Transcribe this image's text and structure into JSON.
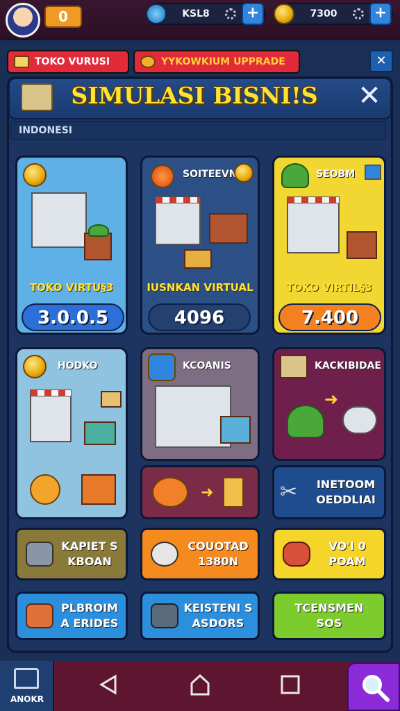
{
  "top_bar": {
    "level_value": "0",
    "resource_1": {
      "value": "KSL8",
      "icon": "swirl-icon"
    },
    "resource_2": {
      "value": "7300",
      "icon": "coin-icon"
    },
    "plus_label": "+"
  },
  "tabs": [
    {
      "label": "TOKO VURUSI",
      "color": "#e22a3a"
    },
    {
      "label": "YYKOWKIUM UPPRADE",
      "color": "#e22a3a"
    }
  ],
  "tab_close": "✕",
  "panel": {
    "title": "SIMULASI BISNI!S",
    "subtitle": "INDONESI",
    "close": "✕"
  },
  "cards": [
    {
      "head": "",
      "label": "TOKO VIRTU§3",
      "price": "3.0.0.5",
      "bg": "#5fb0e6",
      "price_bg": "#2c6fd6"
    },
    {
      "head": "SOITEEVN",
      "label": "IUSNKAN VIRTUAL",
      "price": "4096",
      "bg": "#2c4f86",
      "price_bg": "#24406e"
    },
    {
      "head": "SEOBM",
      "label": "TOKO VIRTIL§3",
      "price": "7.400",
      "bg": "#f2d732",
      "price_bg": "#f4801f"
    },
    {
      "head": "HODKO",
      "label": "",
      "price": "",
      "bg": "#8fc3e0",
      "price_bg": ""
    },
    {
      "head": "KCOANIS",
      "label": "",
      "price": "",
      "bg": "#7e6e84",
      "price_bg": ""
    },
    {
      "head": "KACKIBIDAE",
      "label": "",
      "price": "",
      "bg": "#6e1f4c",
      "price_bg": ""
    }
  ],
  "small_buttons": [
    {
      "label": "",
      "bg": "#7a2b48"
    },
    {
      "label": "INETOOM\nOEDDLIAI",
      "bg": "#1f4c8e"
    }
  ],
  "action_buttons": [
    {
      "label": "KAPIET S\nKBOAN",
      "bg": "#8a7a3a"
    },
    {
      "label": "COUOTAD\n1380N",
      "bg": "#f58a1f"
    },
    {
      "label": "VO'I 0\nPOAM",
      "bg": "#f5d52a"
    },
    {
      "label": "PLBROIM\nA ERIDES",
      "bg": "#2b8fde"
    },
    {
      "label": "KEISTENI S\nASDORS",
      "bg": "#2b8fde"
    },
    {
      "label": "TCENSMEN\nSOS",
      "bg": "#7ccc2e"
    }
  ],
  "nav": {
    "home_label": "ANOKR"
  }
}
